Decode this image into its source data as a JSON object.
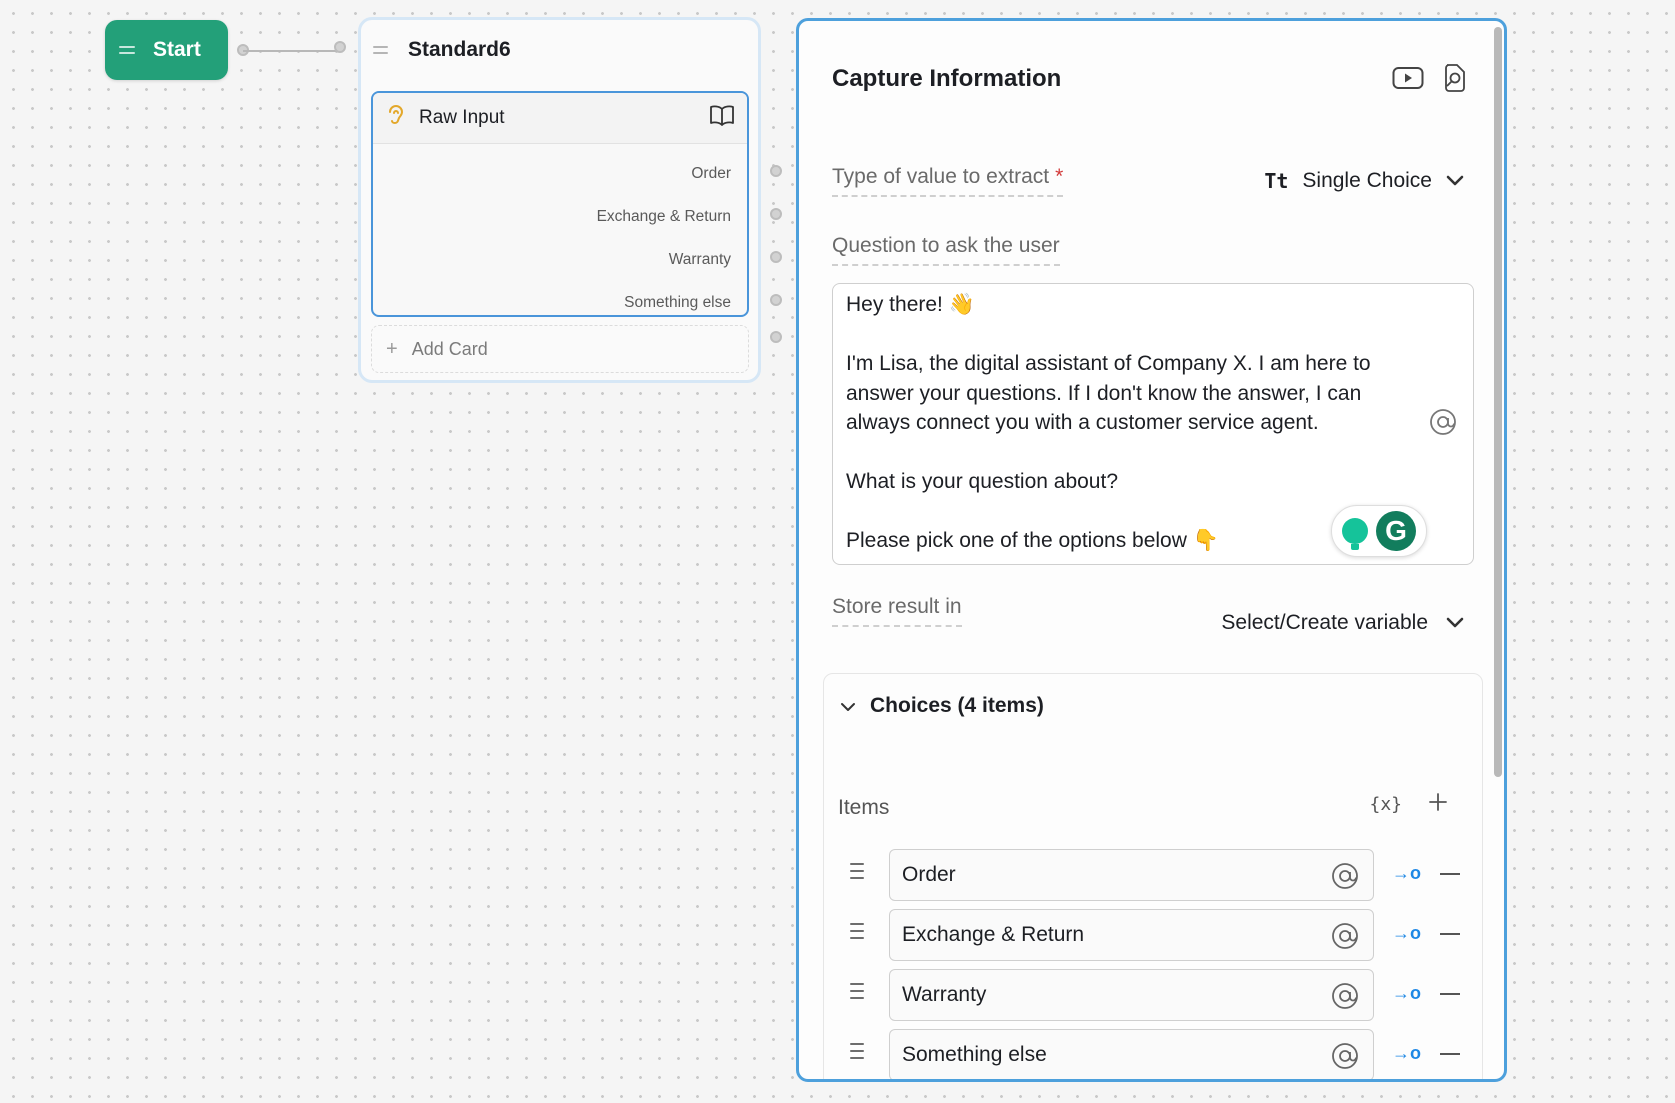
{
  "start_node": {
    "label": "Start"
  },
  "standard_node": {
    "title": "Standard6",
    "card": {
      "title": "Raw Input",
      "options": [
        "Order",
        "Exchange & Return",
        "Warranty",
        "Something else"
      ]
    },
    "add_card_label": "Add Card"
  },
  "panel": {
    "title": "Capture Information",
    "type_label": "Type of value to extract",
    "type_value": "Single Choice",
    "type_icon_text": "Tt",
    "question_label": "Question to ask the user",
    "question_lines": [
      "Hey there! 👋",
      "",
      "I'm Lisa, the digital assistant of Company X. I am here to",
      "answer your questions. If I don't know the answer, I can",
      "always connect you with a customer service agent.",
      "",
      "What is your question about?",
      "",
      "Please pick one of the options below 👇"
    ],
    "store_label": "Store result in",
    "store_value": "Select/Create variable",
    "choices_title": "Choices (4 items)",
    "items_label": "Items",
    "variable_icon_text": "{x}",
    "link_icon_text": "→o",
    "items": [
      "Order",
      "Exchange & Return",
      "Warranty",
      "Something else"
    ]
  },
  "icons": {
    "video": "video-play-icon",
    "search_doc": "document-search-icon",
    "book": "book-icon",
    "ear": "ear-icon",
    "at": "at-sign-icon",
    "chevron": "chevron-down-icon",
    "plus": "plus-icon",
    "minus": "minus-icon",
    "grip": "drag-handle-icon",
    "grammarly": "grammarly-icon"
  },
  "colors": {
    "start_green": "#23a079",
    "accent_blue": "#4da0dc",
    "required_red": "#d23a3a",
    "link_blue": "#1e88e5"
  }
}
